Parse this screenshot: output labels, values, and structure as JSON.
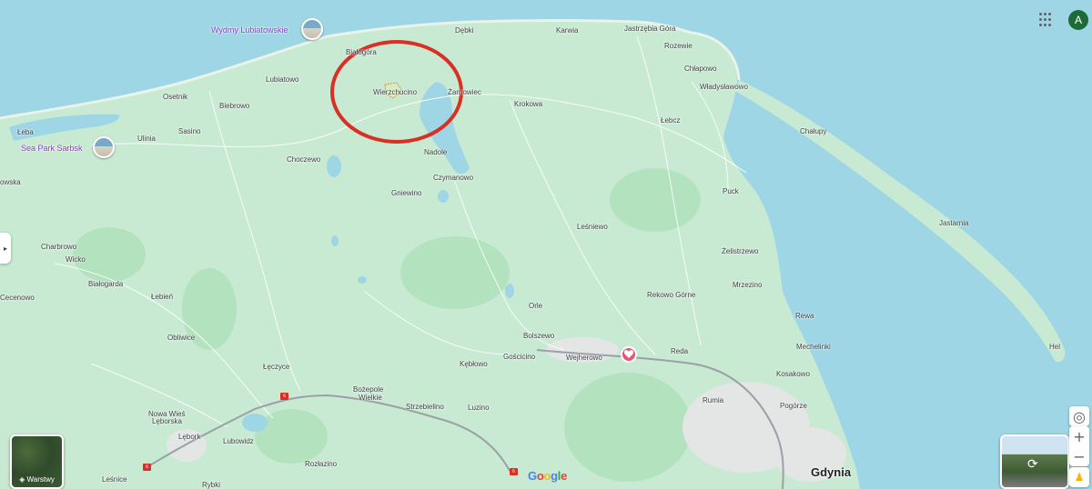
{
  "places": [
    {
      "name": "Dębki",
      "cls": ""
    },
    {
      "name": "Karwia",
      "cls": ""
    },
    {
      "name": "Jastrzębia Góra",
      "cls": ""
    },
    {
      "name": "Rozewie",
      "cls": ""
    },
    {
      "name": "Białogóra",
      "cls": ""
    },
    {
      "name": "Lubiatowo",
      "cls": ""
    },
    {
      "name": "Chłapowo",
      "cls": ""
    },
    {
      "name": "Władysławowo",
      "cls": ""
    },
    {
      "name": "Osetnik",
      "cls": ""
    },
    {
      "name": "Wierzchucino",
      "cls": ""
    },
    {
      "name": "Żarnowiec",
      "cls": ""
    },
    {
      "name": "Biebrowo",
      "cls": ""
    },
    {
      "name": "Krokowa",
      "cls": ""
    },
    {
      "name": "Łeba",
      "cls": ""
    },
    {
      "name": "Sasino",
      "cls": ""
    },
    {
      "name": "Łebcz",
      "cls": ""
    },
    {
      "name": "Chałupy",
      "cls": ""
    },
    {
      "name": "Ulinia",
      "cls": ""
    },
    {
      "name": "Nadole",
      "cls": ""
    },
    {
      "name": "Choczewo",
      "cls": ""
    },
    {
      "name": "Czymanowo",
      "cls": ""
    },
    {
      "name": "owska",
      "cls": ""
    },
    {
      "name": "Gniewino",
      "cls": ""
    },
    {
      "name": "Puck",
      "cls": ""
    },
    {
      "name": "Jastarnia",
      "cls": ""
    },
    {
      "name": "Leśniewo",
      "cls": ""
    },
    {
      "name": "Charbrowo",
      "cls": ""
    },
    {
      "name": "Żelistrzewo",
      "cls": ""
    },
    {
      "name": "Wicko",
      "cls": ""
    },
    {
      "name": "Białogarda",
      "cls": ""
    },
    {
      "name": "Mrzezino",
      "cls": ""
    },
    {
      "name": "Łebień",
      "cls": ""
    },
    {
      "name": "Rekowo Górne",
      "cls": ""
    },
    {
      "name": "Cecenowo",
      "cls": ""
    },
    {
      "name": "Orle",
      "cls": ""
    },
    {
      "name": "Rewa",
      "cls": ""
    },
    {
      "name": "Bolszewo",
      "cls": ""
    },
    {
      "name": "Obliwice",
      "cls": ""
    },
    {
      "name": "Mechelinki",
      "cls": ""
    },
    {
      "name": "Hel",
      "cls": ""
    },
    {
      "name": "Reda",
      "cls": ""
    },
    {
      "name": "Gościcino",
      "cls": ""
    },
    {
      "name": "Wejherowo",
      "cls": ""
    },
    {
      "name": "Kębłowo",
      "cls": ""
    },
    {
      "name": "Łęczyce",
      "cls": ""
    },
    {
      "name": "Kosakowo",
      "cls": ""
    },
    {
      "name": "Bożepole",
      "cls": ""
    },
    {
      "name": "Wielkie",
      "cls": ""
    },
    {
      "name": "Rumia",
      "cls": ""
    },
    {
      "name": "Strzebielino",
      "cls": ""
    },
    {
      "name": "Pogórze",
      "cls": ""
    },
    {
      "name": "Luzino",
      "cls": ""
    },
    {
      "name": "Nowa Wieś",
      "cls": ""
    },
    {
      "name": "Lęborska",
      "cls": ""
    },
    {
      "name": "Lębork",
      "cls": ""
    },
    {
      "name": "Lubowidz",
      "cls": ""
    },
    {
      "name": "Rozłazino",
      "cls": ""
    },
    {
      "name": "Gdynia",
      "cls": "big"
    },
    {
      "name": "Leśnice",
      "cls": ""
    },
    {
      "name": "Rybki",
      "cls": ""
    }
  ],
  "pois": [
    {
      "name": "Wydmy Lubiatowskie"
    },
    {
      "name": "Sea Park Sarbsk"
    }
  ],
  "road_shields": [
    "6",
    "6",
    "6"
  ],
  "controls": {
    "layers_label": "Warstwy",
    "zoom_in": "+",
    "zoom_out": "−",
    "avatar_letter": "A",
    "google": [
      "G",
      "o",
      "o",
      "g",
      "l",
      "e"
    ]
  },
  "colors": {
    "sea": "#9fd6e6",
    "land": "#c8ebd0",
    "forest": "#a8dcb4",
    "highlight_circle": "#d93025",
    "favorite_pin": "#e8557a"
  }
}
